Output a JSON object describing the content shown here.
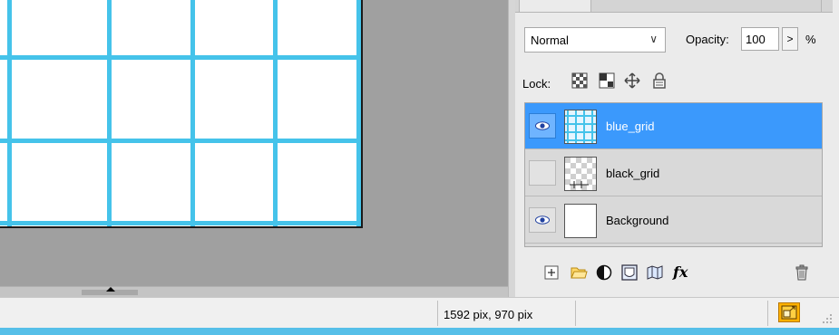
{
  "canvas": {
    "grid_color": "#45c3ea",
    "background": "#a0a0a0"
  },
  "layers_panel": {
    "blend_mode": "Normal",
    "opacity_label": "Opacity:",
    "opacity_value": "100",
    "opacity_button": ">",
    "opacity_unit": "%",
    "lock_label": "Lock:",
    "layers": [
      {
        "name": "blue_grid",
        "visible": true,
        "selected": true
      },
      {
        "name": "black_grid",
        "visible": false,
        "selected": false
      },
      {
        "name": "Background",
        "visible": true,
        "selected": false
      }
    ],
    "selected_color": "#3b99fc"
  },
  "status_bar": {
    "dimensions": "1592 pix, 970 pix"
  }
}
